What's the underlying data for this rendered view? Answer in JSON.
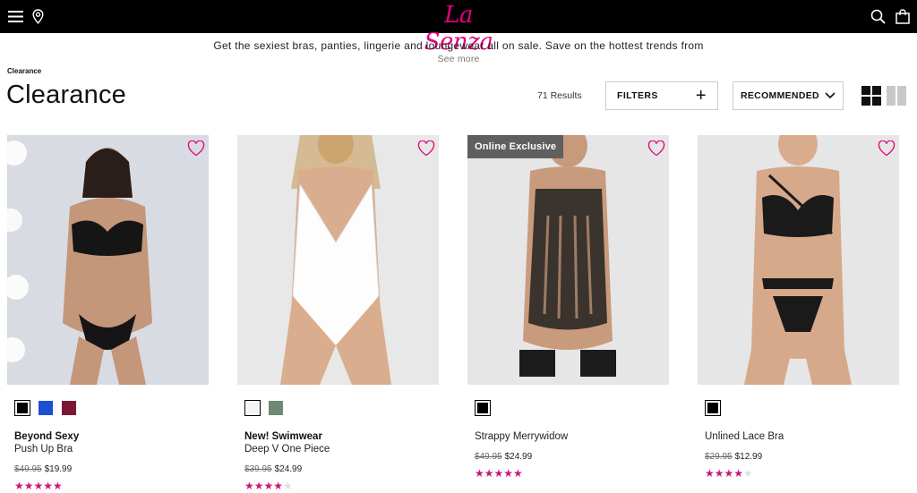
{
  "header": {
    "logo_text": "La Senza",
    "brand_color": "#e4007c",
    "icons": [
      "menu-icon",
      "location-icon",
      "search-icon",
      "shopping-bag-icon"
    ]
  },
  "promo": {
    "text": "Get the sexiest bras, panties, lingerie and loungewear all on sale. Save on the hottest trends from",
    "see_more": "See more"
  },
  "breadcrumb": "Clearance",
  "page_title": "Clearance",
  "toolbar": {
    "results": "71 Results",
    "filters_label": "FILTERS",
    "sort_label": "RECOMMENDED",
    "view_icons": [
      "grid-4-icon",
      "grid-2-icon"
    ]
  },
  "products": [
    {
      "badge": "",
      "brand": "Beyond Sexy",
      "name": "Push Up Bra",
      "old_price": "$49.95",
      "price": "$19.99",
      "rating": 5,
      "swatches": [
        "#000000",
        "#1f4fd1",
        "#7a1836"
      ],
      "image_bg": "#dcdfe6"
    },
    {
      "badge": "",
      "brand": "New! Swimwear",
      "name": "Deep V One Piece",
      "old_price": "$39.95",
      "price": "$24.99",
      "rating": 4.5,
      "swatches": [
        "#f4f4f6",
        "#6f8a72"
      ],
      "image_bg": "#e8e8e8"
    },
    {
      "badge": "Online Exclusive",
      "brand": "",
      "name": "Strappy Merrywidow",
      "old_price": "$49.95",
      "price": "$24.99",
      "rating": 5,
      "swatches": [
        "#000000"
      ],
      "image_bg": "#e6e6e6"
    },
    {
      "badge": "",
      "brand": "",
      "name": "Unlined Lace Bra",
      "old_price": "$29.95",
      "price": "$12.99",
      "rating": 4,
      "swatches": [
        "#000000"
      ],
      "image_bg": "#e6e6e6"
    }
  ]
}
